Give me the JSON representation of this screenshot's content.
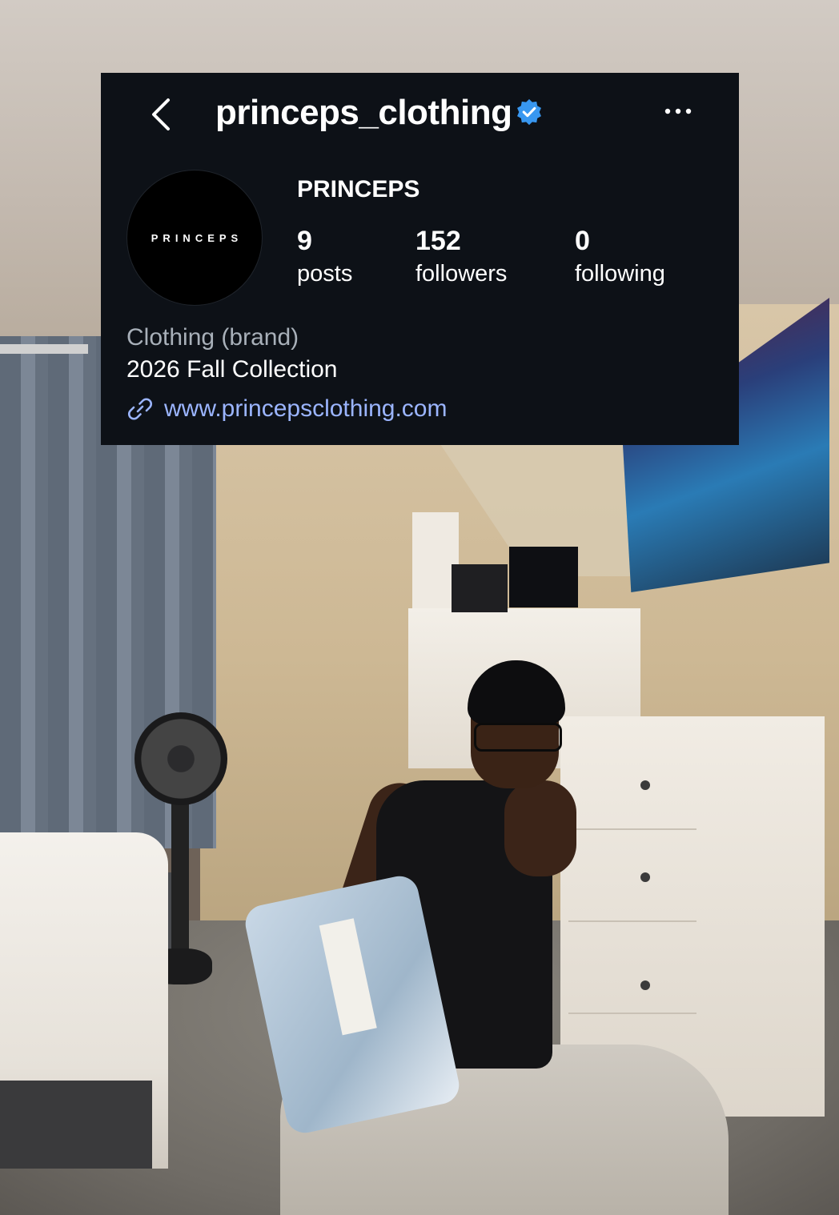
{
  "profile": {
    "username": "princeps_clothing",
    "verified": true,
    "avatar_text": "PRINCEPS",
    "display_name": "PRINCEPS",
    "stats": {
      "posts": {
        "value": "9",
        "label": "posts"
      },
      "followers": {
        "value": "152",
        "label": "followers"
      },
      "following": {
        "value": "0",
        "label": "following"
      }
    },
    "category": "Clothing (brand)",
    "bio": "2026 Fall Collection",
    "link": "www.princepsclothing.com"
  },
  "icons": {
    "back": "chevron-left-icon",
    "verified": "verified-badge-icon",
    "more": "more-horizontal-icon",
    "link": "link-icon"
  },
  "colors": {
    "card_background": "#0d1117",
    "verified_blue": "#3897f0",
    "link_blue": "#9bb5ff",
    "category_gray": "#a8b0b9"
  }
}
